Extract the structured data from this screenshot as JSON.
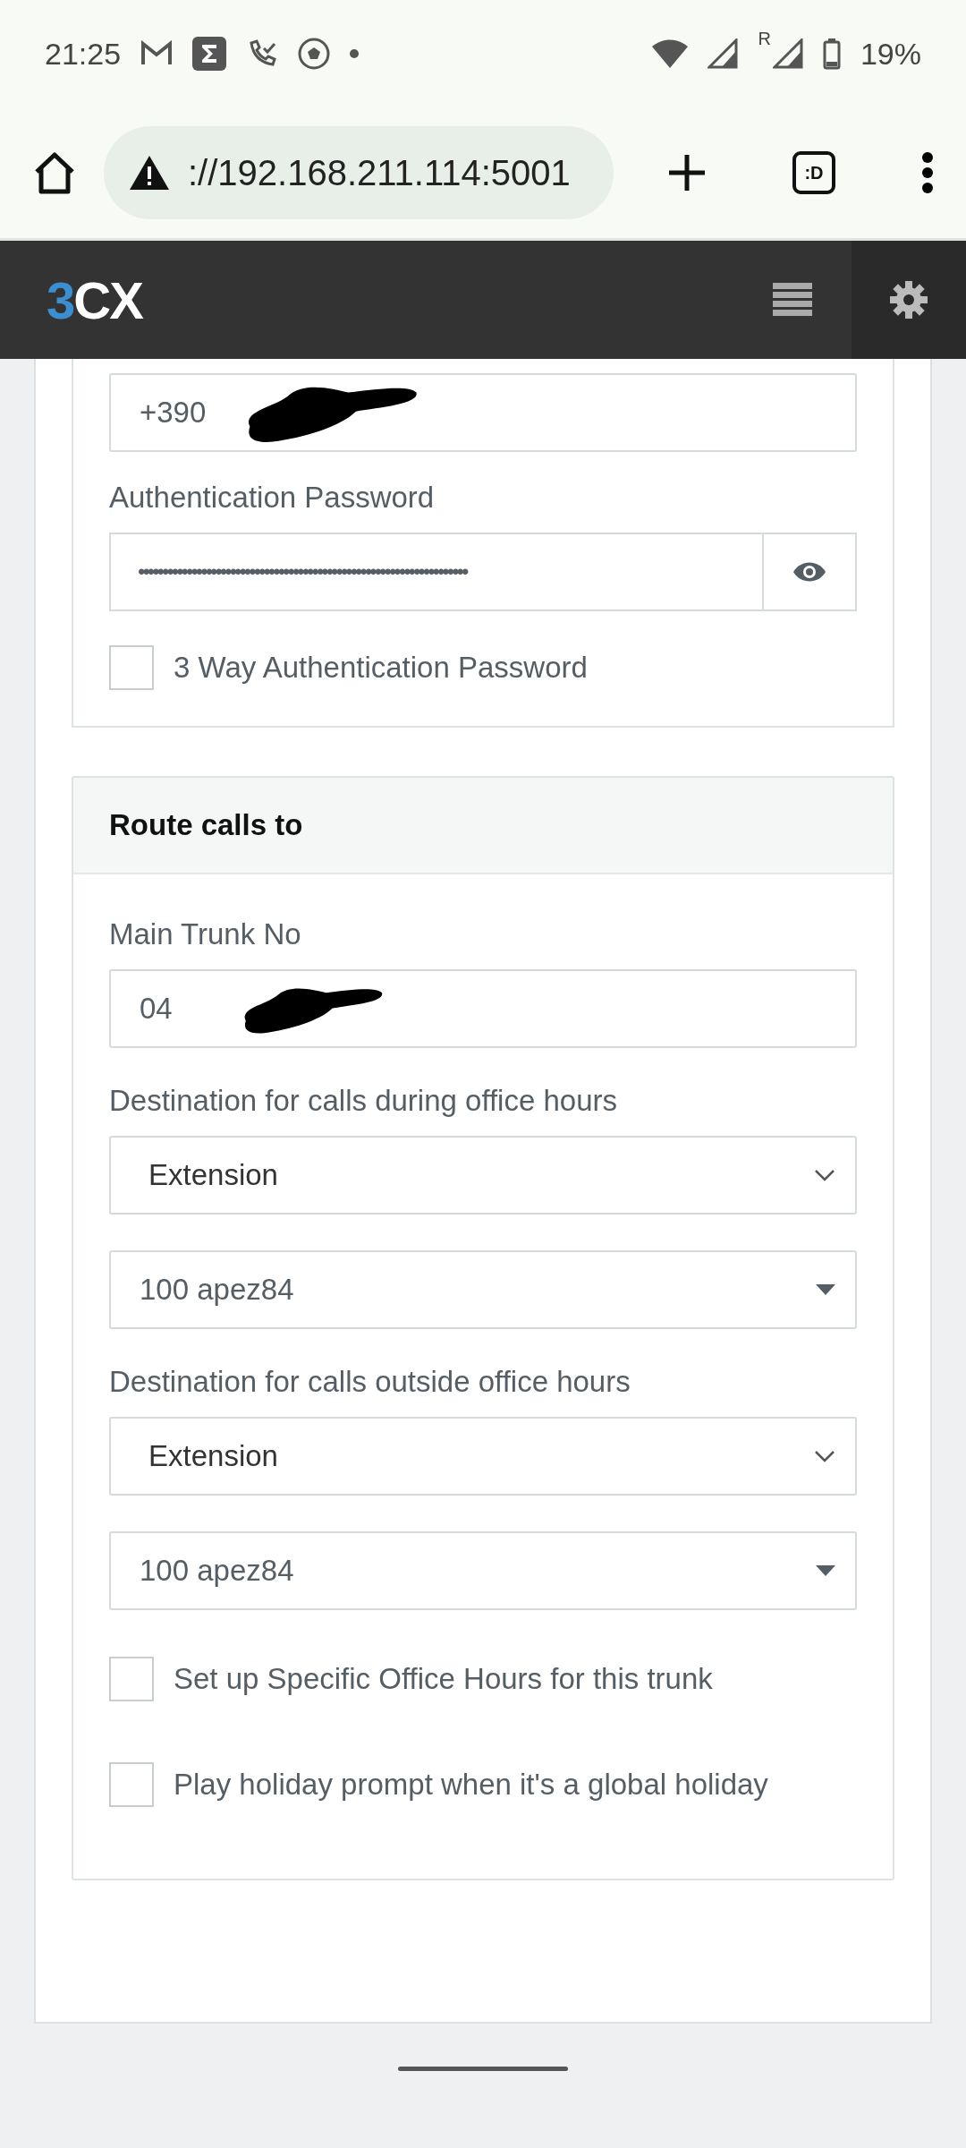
{
  "status_bar": {
    "time": "21:25",
    "roaming_label": "R",
    "battery": "19%"
  },
  "browser": {
    "url": "://192.168.211.114:5001",
    "tabs_button_label": ":D"
  },
  "app_header": {
    "logo": "3CX"
  },
  "auth_panel": {
    "username_field": {
      "value": "+390",
      "redacted": true
    },
    "password": {
      "label": "Authentication Password",
      "value": "••••••••••••••••••••••••••••••••••••••••••••••••••••••••••••••••••••"
    },
    "checkboxes": [
      {
        "label": "3 Way Authentication Password",
        "checked": false
      }
    ]
  },
  "route_panel": {
    "title": "Route calls to",
    "main_trunk": {
      "label": "Main Trunk No",
      "value": "04",
      "redacted": true
    },
    "groups": [
      {
        "label": "Destination for calls during office hours",
        "fields": [
          {
            "kind": "select",
            "value": "Extension"
          },
          {
            "kind": "combo",
            "value": "100 apez84"
          }
        ]
      },
      {
        "label": "Destination for calls outside office hours",
        "fields": [
          {
            "kind": "select",
            "value": "Extension"
          },
          {
            "kind": "combo",
            "value": "100 apez84"
          }
        ]
      }
    ],
    "checkboxes": [
      {
        "label": "Set up Specific Office Hours for this trunk",
        "checked": false
      },
      {
        "label": "Play holiday prompt when it's a global holiday",
        "checked": false
      }
    ]
  }
}
